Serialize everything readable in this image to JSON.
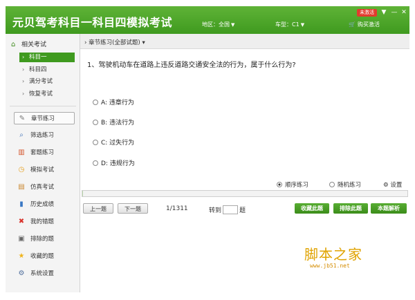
{
  "window": {
    "title": "元贝驾考科目一科目四模拟考试",
    "badge": "未激活",
    "region_label": "地区：全国",
    "car_type_label": "车型：C1",
    "buy_label": "购买激活"
  },
  "sidebar": {
    "section_label": "相关考试",
    "sub_items": [
      {
        "label": "科目一"
      },
      {
        "label": "科目四"
      },
      {
        "label": "满分考试"
      },
      {
        "label": "恢复考试"
      }
    ],
    "nav_items": [
      {
        "label": "章节练习",
        "icon": "pencil-icon"
      },
      {
        "label": "筛选练习",
        "icon": "search-icon"
      },
      {
        "label": "套题练习",
        "icon": "books-icon"
      },
      {
        "label": "模拟考试",
        "icon": "clock-icon"
      },
      {
        "label": "仿真考试",
        "icon": "document-icon"
      },
      {
        "label": "历史成绩",
        "icon": "bar-chart-icon"
      },
      {
        "label": "我的错题",
        "icon": "cross-icon"
      },
      {
        "label": "排除的题",
        "icon": "trash-icon"
      },
      {
        "label": "收藏的题",
        "icon": "star-icon"
      },
      {
        "label": "系统设置",
        "icon": "gear-icon"
      }
    ]
  },
  "main": {
    "breadcrumb": "章节练习(全部试题)",
    "question": "1、驾驶机动车在道路上违反道路交通安全法的行为，属于什么行为?",
    "options": [
      {
        "label": "A: 违章行为"
      },
      {
        "label": "B: 违法行为"
      },
      {
        "label": "C: 过失行为"
      },
      {
        "label": "D: 违规行为"
      }
    ],
    "mode_sequential": "顺序练习",
    "mode_random": "随机练习",
    "settings_label": "设置",
    "progress": 0.0008,
    "prev_label": "上一题",
    "next_label": "下一题",
    "page_info": "1/1311",
    "goto_label": "转到",
    "goto_suffix": "题",
    "favorite_label": "收藏此题",
    "exclude_label": "排除此题",
    "explain_label": "本题解析"
  },
  "watermark": {
    "text": "脚本之家",
    "url": "www.jb51.net"
  },
  "colors": {
    "brand_green": "#3f9a1f",
    "accent_red": "#e23b2e",
    "watermark": "#e0a300"
  }
}
